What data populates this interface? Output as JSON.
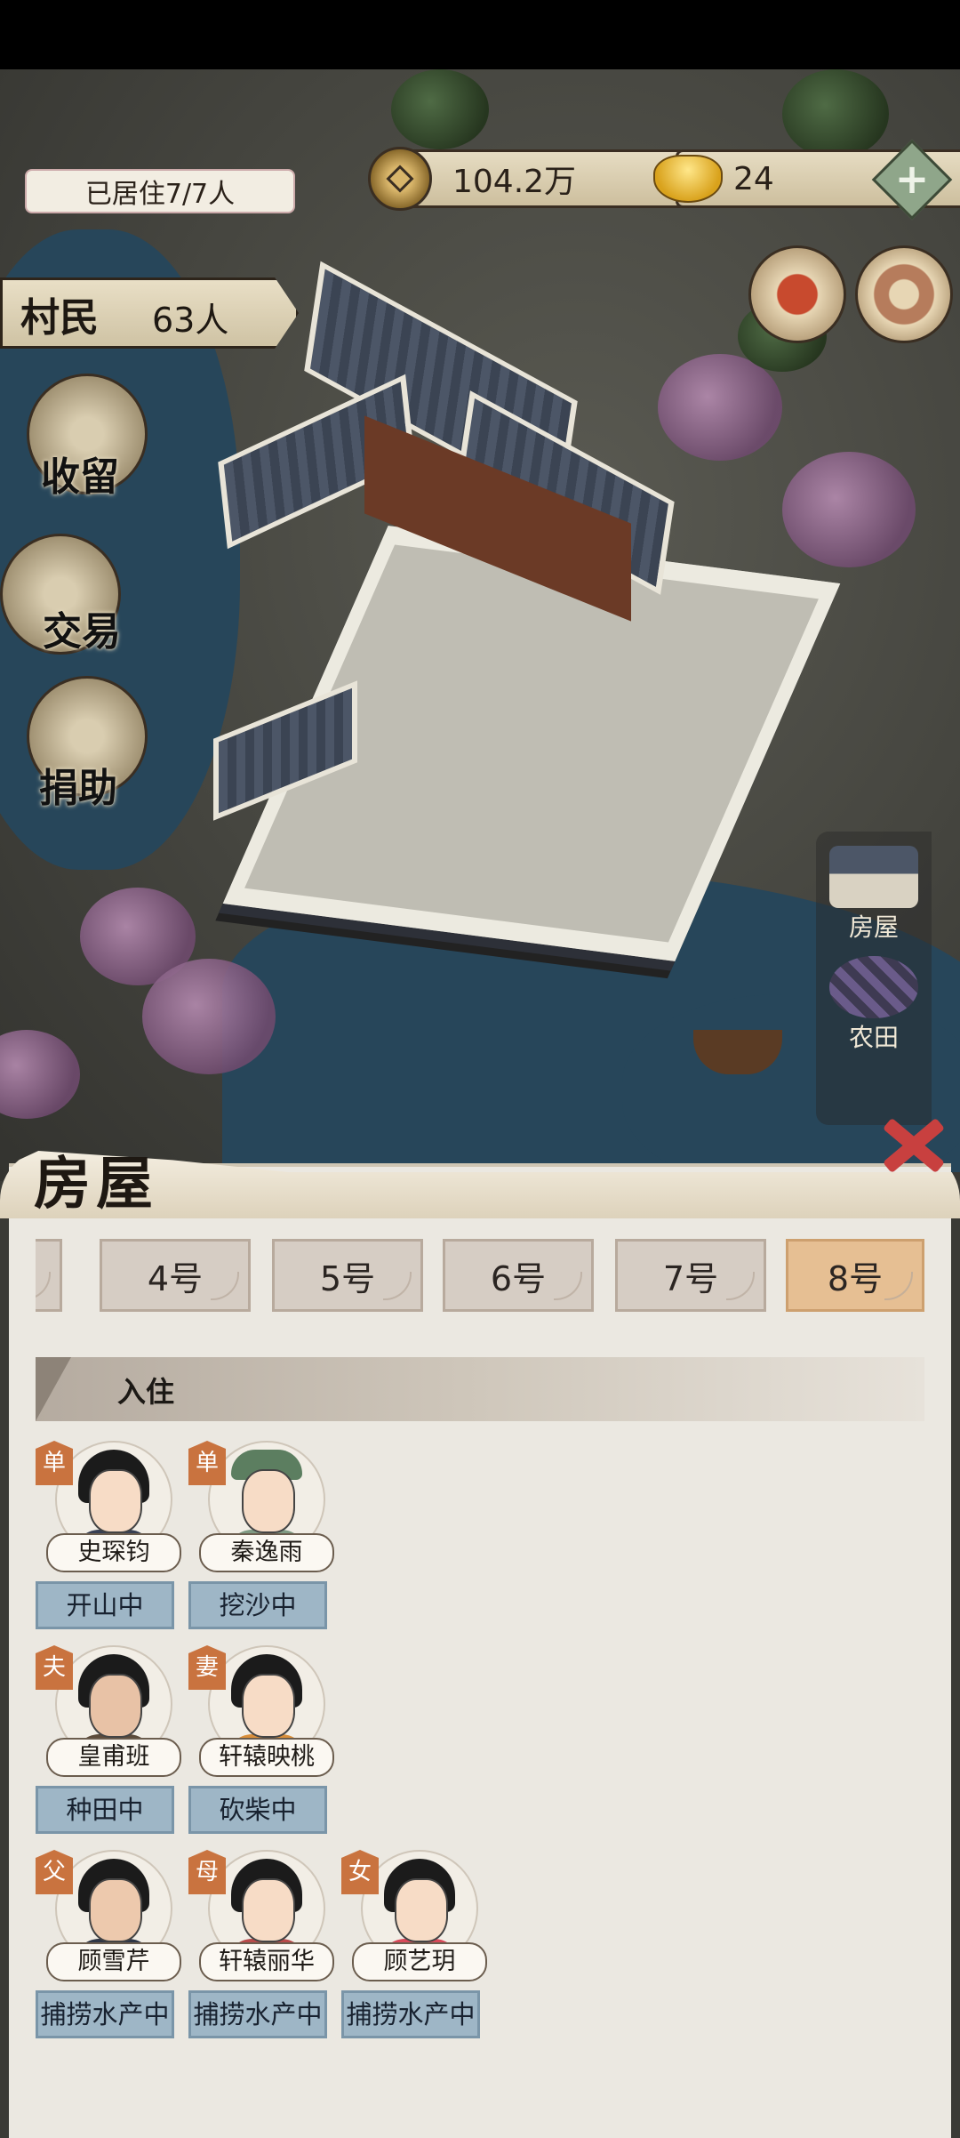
{
  "hud": {
    "occupancy": "已居住7/7人",
    "coins": "104.2万",
    "ingots": "24",
    "plus": "+"
  },
  "sidebar": {
    "villagers_label": "村民",
    "villagers_count": "63人",
    "buttons": [
      "收留",
      "交易",
      "捐助"
    ]
  },
  "right_rail": [
    "房屋",
    "农田"
  ],
  "panel": {
    "title": "房屋",
    "tabs": [
      "4号",
      "5号",
      "6号",
      "7号",
      "8号"
    ],
    "active_tab": "8号",
    "section_title": "入住"
  },
  "residents": [
    {
      "tag": "单",
      "name": "史琛钧",
      "status": "开山中"
    },
    {
      "tag": "单",
      "name": "秦逸雨",
      "status": "挖沙中"
    },
    {
      "tag": "夫",
      "name": "皇甫班",
      "status": "种田中"
    },
    {
      "tag": "妻",
      "name": "轩辕映桃",
      "status": "砍柴中"
    },
    {
      "tag": "父",
      "name": "顾雪芹",
      "status": "捕捞水产中"
    },
    {
      "tag": "母",
      "name": "轩辕丽华",
      "status": "捕捞水产中"
    },
    {
      "tag": "女",
      "name": "顾艺玥",
      "status": "捕捞水产中"
    }
  ],
  "colors": {
    "accent_tab": "#e6bf93",
    "status_chip": "#9eb6c6",
    "tag": "#c9733f",
    "close": "#c8403f"
  }
}
